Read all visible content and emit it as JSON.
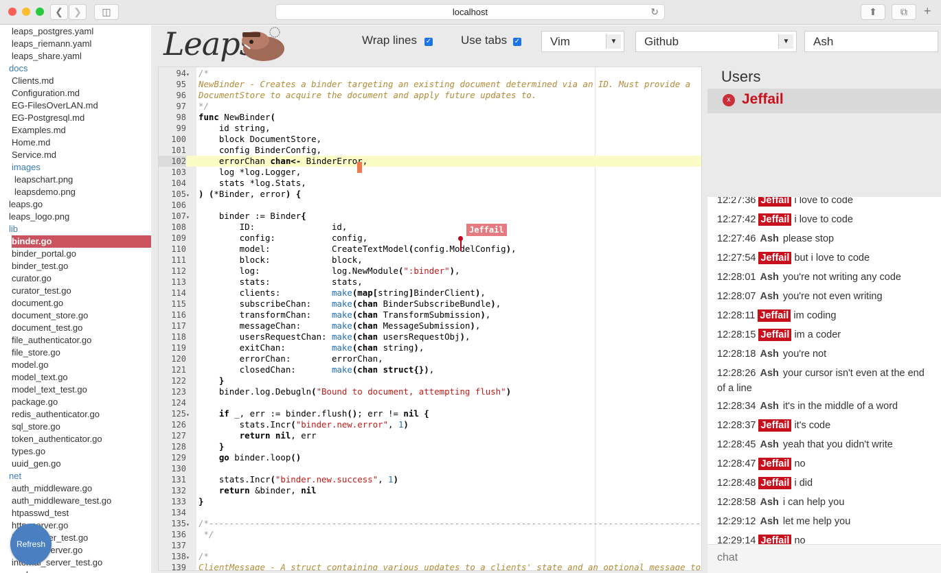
{
  "browser": {
    "url": "localhost",
    "back_icon": "chevron-left-icon",
    "forward_icon": "chevron-right-icon"
  },
  "sidebar": {
    "items": [
      {
        "label": "leaps_postgres.yaml",
        "indent": 1,
        "type": "file"
      },
      {
        "label": "leaps_riemann.yaml",
        "indent": 1,
        "type": "file"
      },
      {
        "label": "leaps_share.yaml",
        "indent": 1,
        "type": "file"
      },
      {
        "label": "docs",
        "indent": 0,
        "type": "dir"
      },
      {
        "label": "Clients.md",
        "indent": 1,
        "type": "file"
      },
      {
        "label": "Configuration.md",
        "indent": 1,
        "type": "file"
      },
      {
        "label": "EG-FilesOverLAN.md",
        "indent": 1,
        "type": "file"
      },
      {
        "label": "EG-Postgresql.md",
        "indent": 1,
        "type": "file"
      },
      {
        "label": "Examples.md",
        "indent": 1,
        "type": "file"
      },
      {
        "label": "Home.md",
        "indent": 1,
        "type": "file"
      },
      {
        "label": "Service.md",
        "indent": 1,
        "type": "file"
      },
      {
        "label": "images",
        "indent": 1,
        "type": "dir"
      },
      {
        "label": "leapschart.png",
        "indent": 2,
        "type": "file"
      },
      {
        "label": "leapsdemo.png",
        "indent": 2,
        "type": "file"
      },
      {
        "label": "leaps.go",
        "indent": 0,
        "type": "file"
      },
      {
        "label": "leaps_logo.png",
        "indent": 0,
        "type": "file"
      },
      {
        "label": "lib",
        "indent": 0,
        "type": "dir"
      },
      {
        "label": "binder.go",
        "indent": 1,
        "type": "file",
        "selected": true
      },
      {
        "label": "binder_portal.go",
        "indent": 1,
        "type": "file"
      },
      {
        "label": "binder_test.go",
        "indent": 1,
        "type": "file"
      },
      {
        "label": "curator.go",
        "indent": 1,
        "type": "file"
      },
      {
        "label": "curator_test.go",
        "indent": 1,
        "type": "file"
      },
      {
        "label": "document.go",
        "indent": 1,
        "type": "file"
      },
      {
        "label": "document_store.go",
        "indent": 1,
        "type": "file"
      },
      {
        "label": "document_test.go",
        "indent": 1,
        "type": "file"
      },
      {
        "label": "file_authenticator.go",
        "indent": 1,
        "type": "file"
      },
      {
        "label": "file_store.go",
        "indent": 1,
        "type": "file"
      },
      {
        "label": "model.go",
        "indent": 1,
        "type": "file"
      },
      {
        "label": "model_text.go",
        "indent": 1,
        "type": "file"
      },
      {
        "label": "model_text_test.go",
        "indent": 1,
        "type": "file"
      },
      {
        "label": "package.go",
        "indent": 1,
        "type": "file"
      },
      {
        "label": "redis_authenticator.go",
        "indent": 1,
        "type": "file"
      },
      {
        "label": "sql_store.go",
        "indent": 1,
        "type": "file"
      },
      {
        "label": "token_authenticator.go",
        "indent": 1,
        "type": "file"
      },
      {
        "label": "types.go",
        "indent": 1,
        "type": "file"
      },
      {
        "label": "uuid_gen.go",
        "indent": 1,
        "type": "file"
      },
      {
        "label": "net",
        "indent": 0,
        "type": "dir"
      },
      {
        "label": "auth_middleware.go",
        "indent": 1,
        "type": "file"
      },
      {
        "label": "auth_middleware_test.go",
        "indent": 1,
        "type": "file"
      },
      {
        "label": "htpasswd_test",
        "indent": 1,
        "type": "file"
      },
      {
        "label": "http_server.go",
        "indent": 1,
        "type": "file"
      },
      {
        "label": "http_server_test.go",
        "indent": 1,
        "type": "file"
      },
      {
        "label": "internal_server.go",
        "indent": 1,
        "type": "file"
      },
      {
        "label": "internal_server_test.go",
        "indent": 1,
        "type": "file"
      },
      {
        "label": "package.go",
        "indent": 1,
        "type": "file"
      }
    ],
    "refresh_label": "Refresh"
  },
  "header": {
    "logo_text": "Leaps",
    "wrap_label": "Wrap lines",
    "wrap_checked": true,
    "tabs_label": "Use tabs",
    "tabs_checked": true,
    "keymap_value": "Vim",
    "theme_value": "Github",
    "username_value": "Ash"
  },
  "editor": {
    "active_line": 102,
    "remote_cursor_user": "Jeffail",
    "lines": [
      {
        "n": 94,
        "fold": "▾",
        "html": "<span class='cm'>/*</span>"
      },
      {
        "n": 95,
        "fold": "",
        "html": "<span class='cmo'>NewBinder - Creates a binder targeting an existing document determined via an ID. Must provide a</span>"
      },
      {
        "n": 96,
        "fold": "",
        "html": "<span class='cmo'>DocumentStore to acquire the document and apply future updates to.</span>"
      },
      {
        "n": 97,
        "fold": "",
        "html": "<span class='cm'>*/</span>"
      },
      {
        "n": 98,
        "fold": "",
        "html": "<span class='kw'>func</span> NewBinder<span class='kw'>(</span>"
      },
      {
        "n": 99,
        "fold": "",
        "html": "    id string,"
      },
      {
        "n": 100,
        "fold": "",
        "html": "    block DocumentStore,"
      },
      {
        "n": 101,
        "fold": "",
        "html": "    config BinderConfig,"
      },
      {
        "n": 102,
        "fold": "",
        "html": "    errorChan <span class='kw'>chan&lt;-</span> BinderError,"
      },
      {
        "n": 103,
        "fold": "",
        "html": "    log *log.Logger,"
      },
      {
        "n": 104,
        "fold": "",
        "html": "    stats *log.Stats,"
      },
      {
        "n": 105,
        "fold": "▾",
        "html": "<span class='kw'>)</span> <span class='kw'>(</span>*Binder, error<span class='kw'>)</span> <span class='kw'>{</span>"
      },
      {
        "n": 106,
        "fold": "",
        "html": ""
      },
      {
        "n": 107,
        "fold": "▾",
        "html": "    binder := Binder<span class='kw'>{</span>"
      },
      {
        "n": 108,
        "fold": "",
        "html": "        ID:               id,"
      },
      {
        "n": 109,
        "fold": "",
        "html": "        config:           config,"
      },
      {
        "n": 110,
        "fold": "",
        "html": "        model:            CreateTextModel<span class='kw'>(</span>config.ModelConfig<span class='kw'>)</span>,"
      },
      {
        "n": 111,
        "fold": "",
        "html": "        block:            block,"
      },
      {
        "n": 112,
        "fold": "",
        "html": "        log:              log.NewModule<span class='kw'>(</span><span class='str'>\":binder\"</span><span class='kw'>)</span>,"
      },
      {
        "n": 113,
        "fold": "",
        "html": "        stats:            stats,"
      },
      {
        "n": 114,
        "fold": "",
        "html": "        clients:          <span class='mk'>make</span><span class='kw'>(map[</span>string<span class='kw'>]</span>BinderClient<span class='kw'>)</span>,"
      },
      {
        "n": 115,
        "fold": "",
        "html": "        subscribeChan:    <span class='mk'>make</span><span class='kw'>(chan</span> BinderSubscribeBundle<span class='kw'>)</span>,"
      },
      {
        "n": 116,
        "fold": "",
        "html": "        transformChan:    <span class='mk'>make</span><span class='kw'>(chan</span> TransformSubmission<span class='kw'>)</span>,"
      },
      {
        "n": 117,
        "fold": "",
        "html": "        messageChan:      <span class='mk'>make</span><span class='kw'>(chan</span> MessageSubmission<span class='kw'>)</span>,"
      },
      {
        "n": 118,
        "fold": "",
        "html": "        usersRequestChan: <span class='mk'>make</span><span class='kw'>(chan</span> usersRequestObj<span class='kw'>)</span>,"
      },
      {
        "n": 119,
        "fold": "",
        "html": "        exitChan:         <span class='mk'>make</span><span class='kw'>(chan</span> string<span class='kw'>)</span>,"
      },
      {
        "n": 120,
        "fold": "",
        "html": "        errorChan:        errorChan,"
      },
      {
        "n": 121,
        "fold": "",
        "html": "        closedChan:       <span class='mk'>make</span><span class='kw'>(chan struct{})</span>,"
      },
      {
        "n": 122,
        "fold": "",
        "html": "    <span class='kw'>}</span>"
      },
      {
        "n": 123,
        "fold": "",
        "html": "    binder.log.Debugln<span class='kw'>(</span><span class='str'>\"Bound to document, attempting flush\"</span><span class='kw'>)</span>"
      },
      {
        "n": 124,
        "fold": "",
        "html": ""
      },
      {
        "n": 125,
        "fold": "▾",
        "html": "    <span class='kw'>if</span> _, err := binder.flush<span class='kw'>()</span>; err != <span class='kw'>nil {</span>"
      },
      {
        "n": 126,
        "fold": "",
        "html": "        stats.Incr<span class='kw'>(</span><span class='str'>\"binder.new.error\"</span>, <span class='mk'>1</span><span class='kw'>)</span>"
      },
      {
        "n": 127,
        "fold": "",
        "html": "        <span class='kw'>return nil</span>, err"
      },
      {
        "n": 128,
        "fold": "",
        "html": "    <span class='kw'>}</span>"
      },
      {
        "n": 129,
        "fold": "",
        "html": "    <span class='kw'>go</span> binder.loop<span class='kw'>()</span>"
      },
      {
        "n": 130,
        "fold": "",
        "html": ""
      },
      {
        "n": 131,
        "fold": "",
        "html": "    stats.Incr<span class='kw'>(</span><span class='str'>\"binder.new.success\"</span>, <span class='mk'>1</span><span class='kw'>)</span>"
      },
      {
        "n": 132,
        "fold": "",
        "html": "    <span class='kw'>return</span> &amp;binder, <span class='kw'>nil</span>"
      },
      {
        "n": 133,
        "fold": "",
        "html": "<span class='kw'>}</span>"
      },
      {
        "n": 134,
        "fold": "",
        "html": ""
      },
      {
        "n": 135,
        "fold": "▾",
        "html": "<span class='cm'>/*--------------------------------------------------------------------------------------------------</span>"
      },
      {
        "n": 136,
        "fold": "",
        "html": "<span class='cm'> */</span>"
      },
      {
        "n": 137,
        "fold": "",
        "html": ""
      },
      {
        "n": 138,
        "fold": "▾",
        "html": "<span class='cm'>/*</span>"
      },
      {
        "n": 139,
        "fold": "",
        "html": "<span class='cmo'>ClientMessage - A struct containing various updates to a clients' state and an optional message to</span>"
      }
    ]
  },
  "users": {
    "title": "Users",
    "list": [
      {
        "name": "Jeffail"
      }
    ]
  },
  "chat": {
    "placeholder": "chat",
    "messages": [
      {
        "ts": "12:27:36",
        "who": "Jeffail",
        "text": "i love to code"
      },
      {
        "ts": "12:27:42",
        "who": "Jeffail",
        "text": "i love to code"
      },
      {
        "ts": "12:27:46",
        "who": "Ash",
        "text": "please stop"
      },
      {
        "ts": "12:27:54",
        "who": "Jeffail",
        "text": "but i love to code"
      },
      {
        "ts": "12:28:01",
        "who": "Ash",
        "text": "you're not writing any code"
      },
      {
        "ts": "12:28:07",
        "who": "Ash",
        "text": "you're not even writing"
      },
      {
        "ts": "12:28:11",
        "who": "Jeffail",
        "text": "im coding"
      },
      {
        "ts": "12:28:15",
        "who": "Jeffail",
        "text": "im a coder"
      },
      {
        "ts": "12:28:18",
        "who": "Ash",
        "text": "you're not"
      },
      {
        "ts": "12:28:26",
        "who": "Ash",
        "text": "your cursor isn't even at the end of a line"
      },
      {
        "ts": "12:28:34",
        "who": "Ash",
        "text": "it's in the middle of a word"
      },
      {
        "ts": "12:28:37",
        "who": "Jeffail",
        "text": "it's code"
      },
      {
        "ts": "12:28:45",
        "who": "Ash",
        "text": "yeah that you didn't write"
      },
      {
        "ts": "12:28:47",
        "who": "Jeffail",
        "text": "no"
      },
      {
        "ts": "12:28:48",
        "who": "Jeffail",
        "text": "i did"
      },
      {
        "ts": "12:28:58",
        "who": "Ash",
        "text": "i can help you"
      },
      {
        "ts": "12:29:12",
        "who": "Ash",
        "text": "let me help you"
      },
      {
        "ts": "12:29:14",
        "who": "Jeffail",
        "text": "no"
      }
    ]
  }
}
